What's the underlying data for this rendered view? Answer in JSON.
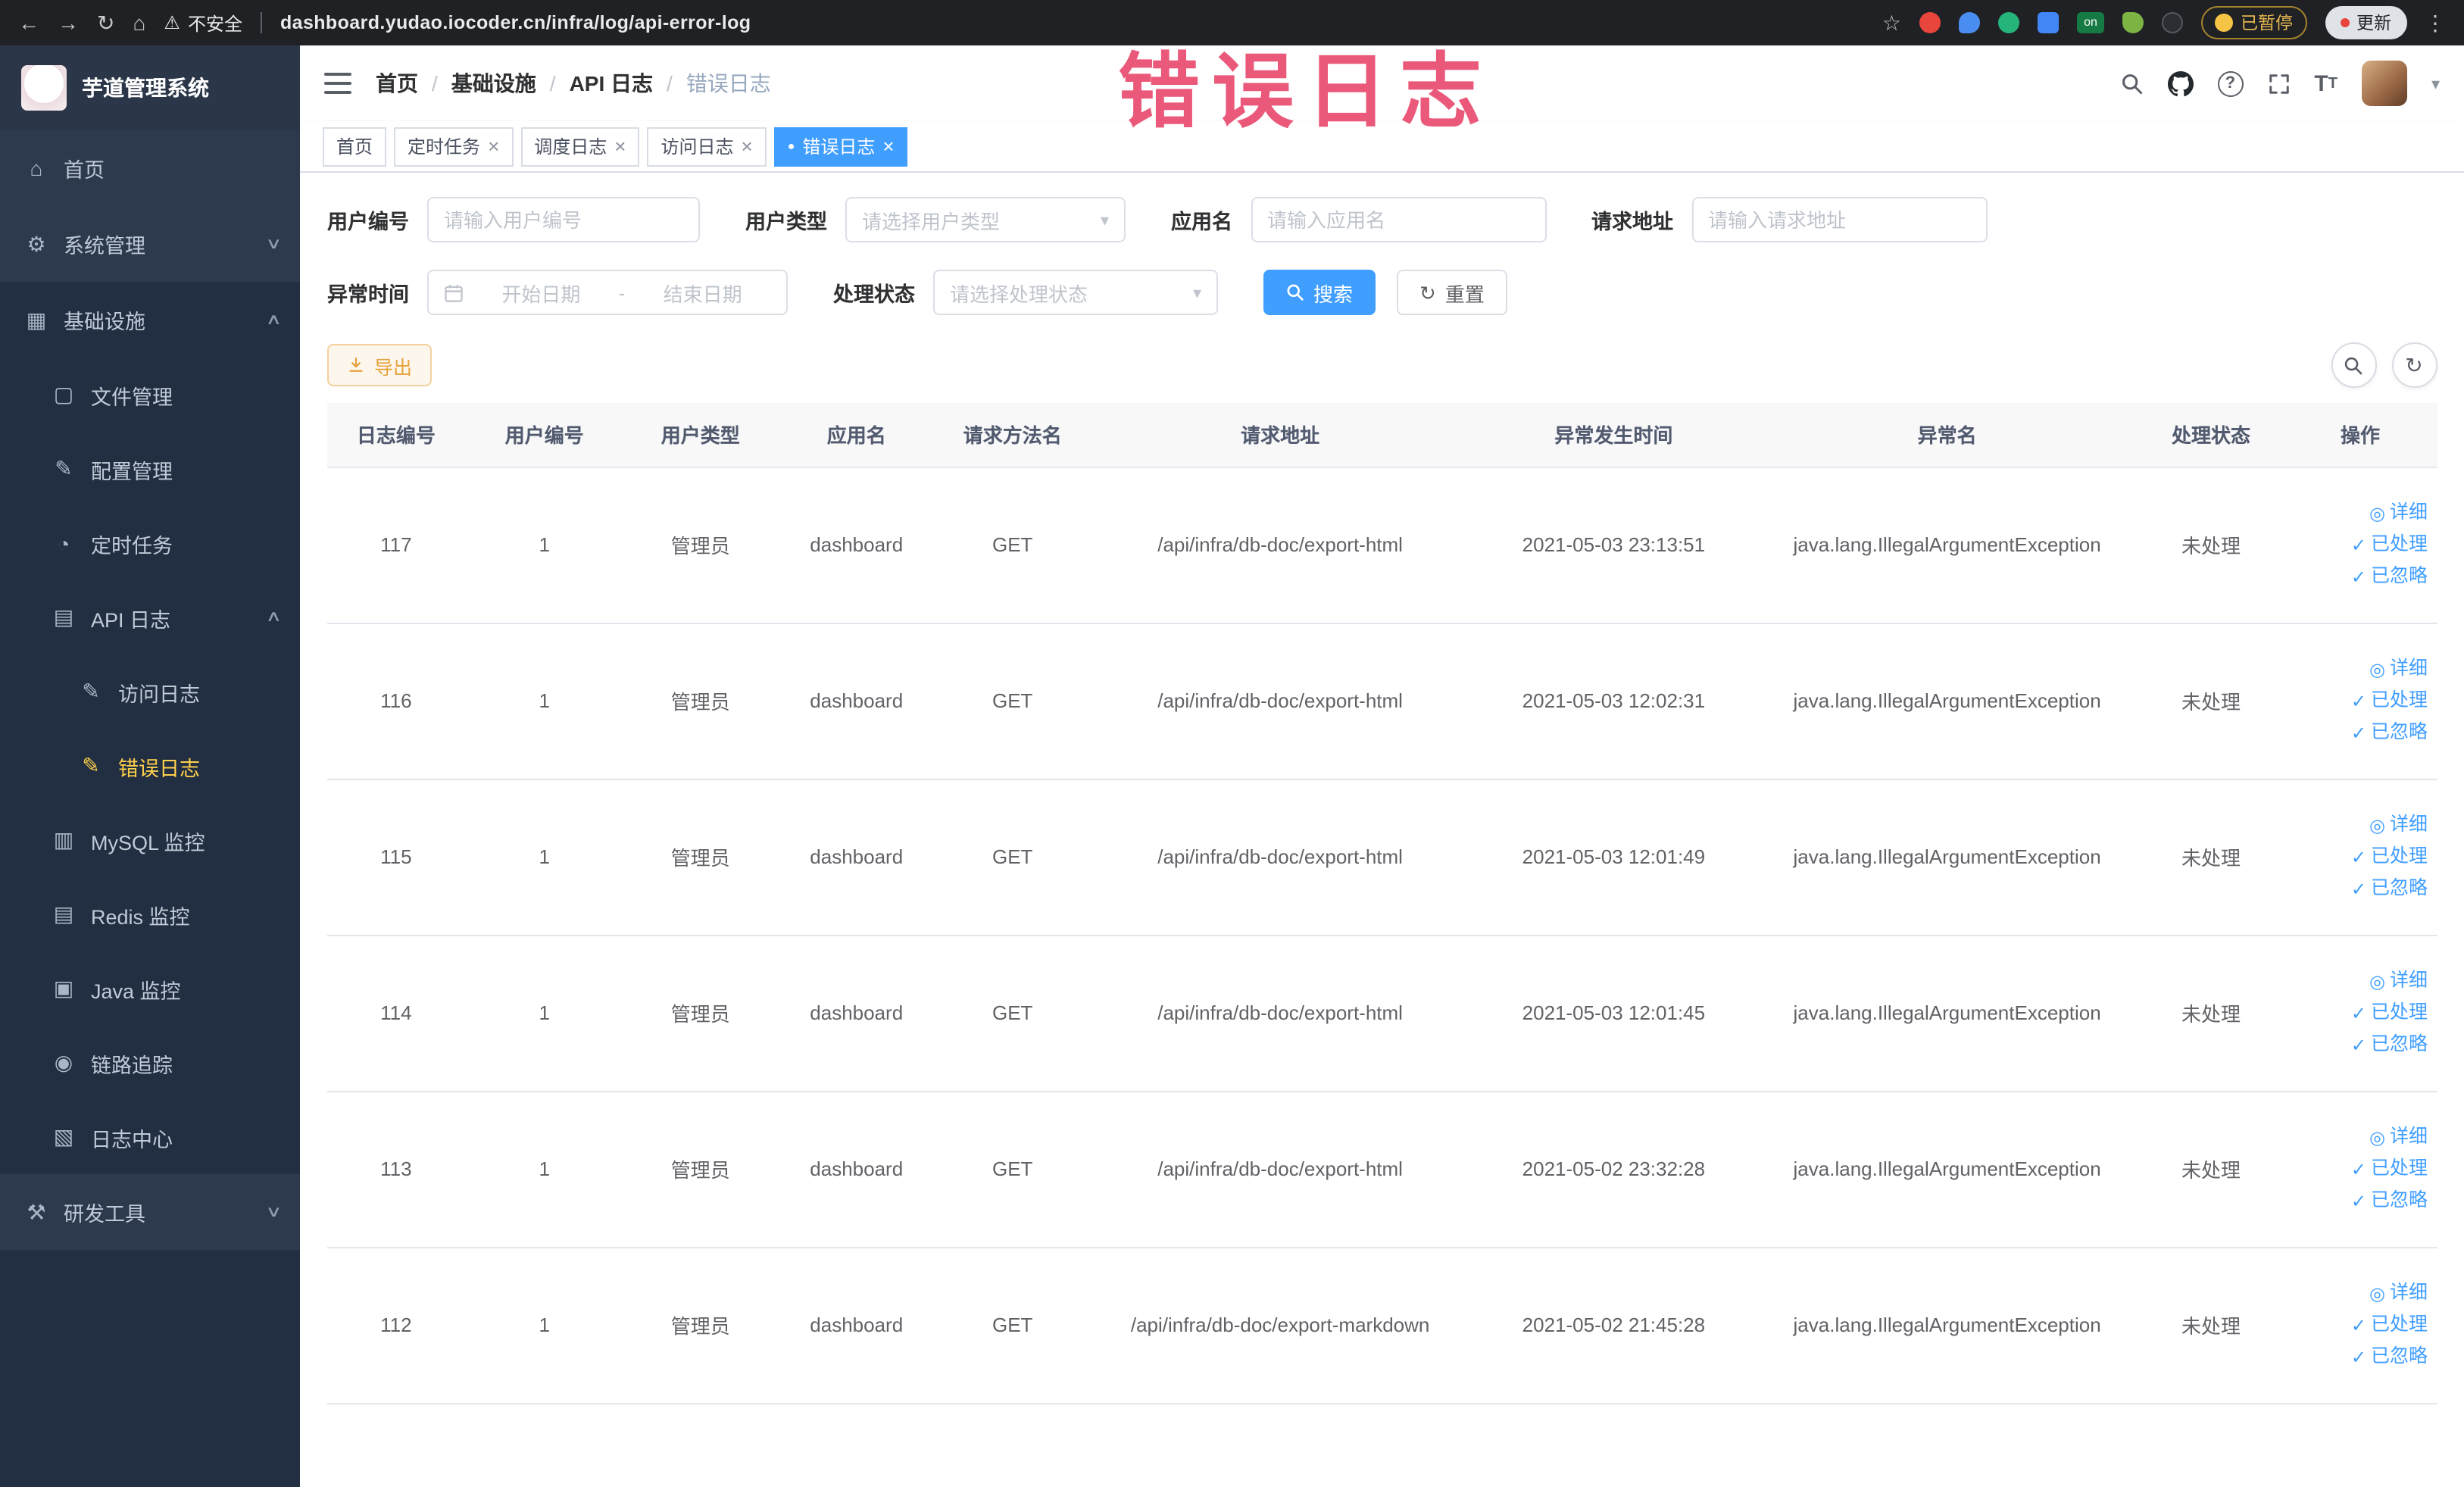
{
  "icons": {
    "back": "←",
    "forward": "→",
    "reload": "↻",
    "home_nav": "⌂",
    "warning": "⚠",
    "star": "☆",
    "menu_dots": "⋮",
    "home": "⌂",
    "system": "⚙",
    "infra": "▦",
    "file": "▢",
    "config": "✎",
    "timer": "◔",
    "api_log": "▤",
    "doc": "✎",
    "mysql": "▥",
    "redis": "▤",
    "java": "▣",
    "trace": "◉",
    "log_center": "▧",
    "devtool": "⚒",
    "chevron_down": "∨",
    "chevron_up": "∧",
    "caret_down": "▾",
    "eye": "◎",
    "check": "✓",
    "dot": "●",
    "close": "×",
    "crumb_sep": "/",
    "range_sep": "-",
    "help": "?",
    "font_big": "T",
    "font_small": "T"
  },
  "browser": {
    "security_label": "不安全",
    "url": "dashboard.yudao.iocoder.cn/infra/log/api-error-log",
    "on_badge": "on",
    "paused_badge": "已暂停",
    "update_button": "更新"
  },
  "annotation": {
    "text": "错误日志"
  },
  "sidebar": {
    "logo_title": "芋道管理系统",
    "items": [
      {
        "label": "首页"
      },
      {
        "label": "系统管理"
      },
      {
        "label": "基础设施",
        "children": [
          {
            "label": "文件管理"
          },
          {
            "label": "配置管理"
          },
          {
            "label": "定时任务"
          },
          {
            "label": "API 日志",
            "children": [
              {
                "label": "访问日志"
              },
              {
                "label": "错误日志"
              }
            ]
          },
          {
            "label": "MySQL 监控"
          },
          {
            "label": "Redis 监控"
          },
          {
            "label": "Java 监控"
          },
          {
            "label": "链路追踪"
          },
          {
            "label": "日志中心"
          }
        ]
      },
      {
        "label": "研发工具"
      }
    ]
  },
  "header": {
    "breadcrumbs": [
      "首页",
      "基础设施",
      "API 日志",
      "错误日志"
    ]
  },
  "tabs": [
    {
      "label": "首页"
    },
    {
      "label": "定时任务"
    },
    {
      "label": "调度日志"
    },
    {
      "label": "访问日志"
    },
    {
      "label": "错误日志"
    }
  ],
  "filters": {
    "user_id": {
      "label": "用户编号",
      "placeholder": "请输入用户编号"
    },
    "user_type": {
      "label": "用户类型",
      "placeholder": "请选择用户类型"
    },
    "app_name": {
      "label": "应用名",
      "placeholder": "请输入应用名"
    },
    "request_url": {
      "label": "请求地址",
      "placeholder": "请输入请求地址"
    },
    "exception_time": {
      "label": "异常时间",
      "start_placeholder": "开始日期",
      "end_placeholder": "结束日期"
    },
    "process_status": {
      "label": "处理状态",
      "placeholder": "请选择处理状态"
    },
    "search_button": "搜索",
    "reset_button": "重置"
  },
  "toolbar": {
    "export_button": "导出"
  },
  "table": {
    "columns": [
      "日志编号",
      "用户编号",
      "用户类型",
      "应用名",
      "请求方法名",
      "请求地址",
      "异常发生时间",
      "异常名",
      "处理状态",
      "操作"
    ],
    "actions": {
      "detail": "详细",
      "processed": "已处理",
      "ignored": "已忽略"
    },
    "rows": [
      {
        "id": "117",
        "user_id": "1",
        "user_type": "管理员",
        "app": "dashboard",
        "method": "GET",
        "url": "/api/infra/db-doc/export-html",
        "time": "2021-05-03 23:13:51",
        "exception": "java.lang.IllegalArgumentException",
        "status": "未处理"
      },
      {
        "id": "116",
        "user_id": "1",
        "user_type": "管理员",
        "app": "dashboard",
        "method": "GET",
        "url": "/api/infra/db-doc/export-html",
        "time": "2021-05-03 12:02:31",
        "exception": "java.lang.IllegalArgumentException",
        "status": "未处理"
      },
      {
        "id": "115",
        "user_id": "1",
        "user_type": "管理员",
        "app": "dashboard",
        "method": "GET",
        "url": "/api/infra/db-doc/export-html",
        "time": "2021-05-03 12:01:49",
        "exception": "java.lang.IllegalArgumentException",
        "status": "未处理"
      },
      {
        "id": "114",
        "user_id": "1",
        "user_type": "管理员",
        "app": "dashboard",
        "method": "GET",
        "url": "/api/infra/db-doc/export-html",
        "time": "2021-05-03 12:01:45",
        "exception": "java.lang.IllegalArgumentException",
        "status": "未处理"
      },
      {
        "id": "113",
        "user_id": "1",
        "user_type": "管理员",
        "app": "dashboard",
        "method": "GET",
        "url": "/api/infra/db-doc/export-html",
        "time": "2021-05-02 23:32:28",
        "exception": "java.lang.IllegalArgumentException",
        "status": "未处理"
      },
      {
        "id": "112",
        "user_id": "1",
        "user_type": "管理员",
        "app": "dashboard",
        "method": "GET",
        "url": "/api/infra/db-doc/export-markdown",
        "time": "2021-05-02 21:45:28",
        "exception": "java.lang.IllegalArgumentException",
        "status": "未处理"
      }
    ]
  }
}
